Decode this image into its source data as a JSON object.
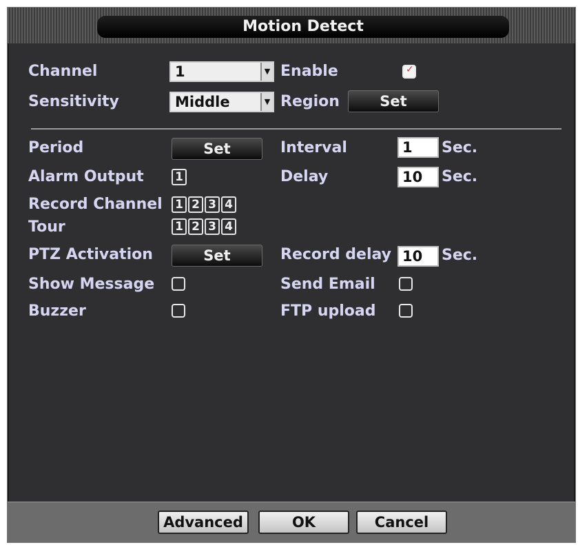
{
  "title": "Motion Detect",
  "channel": {
    "label": "Channel",
    "value": "1"
  },
  "enable": {
    "label": "Enable",
    "checked": true
  },
  "sensitivity": {
    "label": "Sensitivity",
    "value": "Middle"
  },
  "region": {
    "label": "Region",
    "button": "Set"
  },
  "period": {
    "label": "Period",
    "button": "Set"
  },
  "interval": {
    "label": "Interval",
    "value": "1",
    "unit": "Sec."
  },
  "alarm_output": {
    "label": "Alarm Output",
    "channels": [
      "1"
    ]
  },
  "delay": {
    "label": "Delay",
    "value": "10",
    "unit": "Sec."
  },
  "record_channel": {
    "label": "Record Channel",
    "channels": [
      "1",
      "2",
      "3",
      "4"
    ]
  },
  "tour": {
    "label": "Tour",
    "channels": [
      "1",
      "2",
      "3",
      "4"
    ]
  },
  "ptz_activation": {
    "label": "PTZ Activation",
    "button": "Set"
  },
  "record_delay": {
    "label": "Record delay",
    "value": "10",
    "unit": "Sec."
  },
  "show_message": {
    "label": "Show Message",
    "checked": false
  },
  "send_email": {
    "label": "Send Email",
    "checked": false
  },
  "buzzer": {
    "label": "Buzzer",
    "checked": false
  },
  "ftp_upload": {
    "label": "FTP upload",
    "checked": false
  },
  "footer": {
    "advanced": "Advanced",
    "ok": "OK",
    "cancel": "Cancel"
  }
}
